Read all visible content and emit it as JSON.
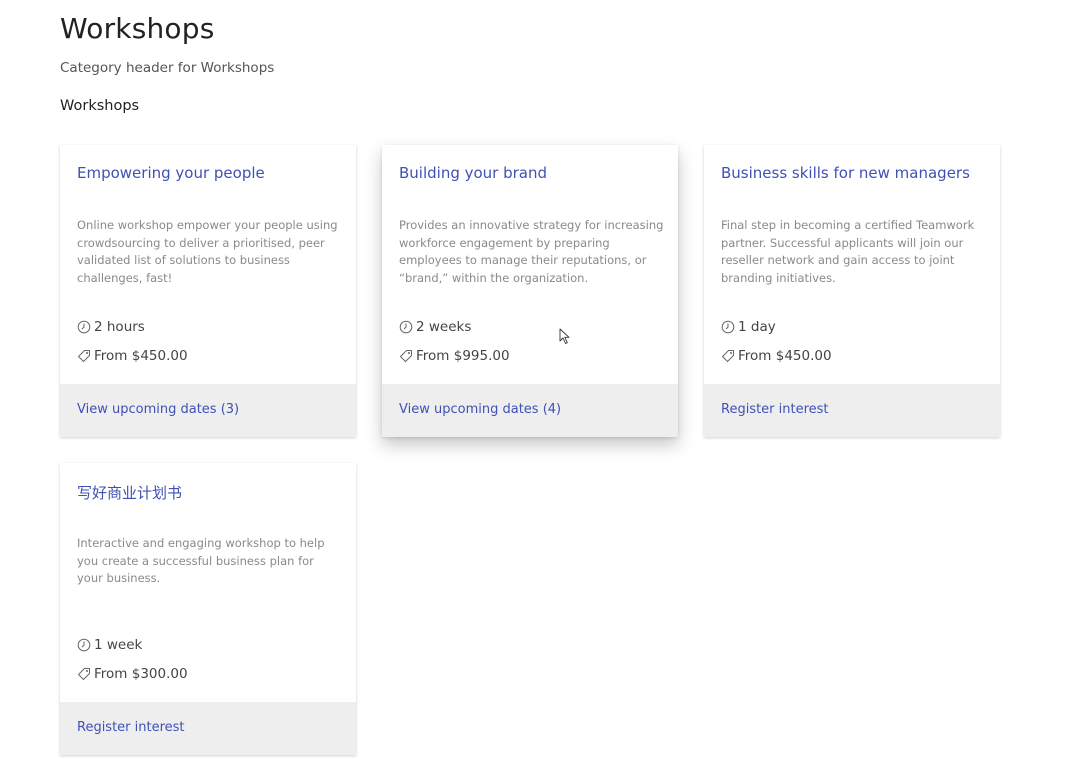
{
  "header": {
    "title": "Workshops",
    "subtitle": "Category header for Workshops",
    "section_title": "Workshops"
  },
  "colors": {
    "link": "#3f51b5",
    "footer_bg": "#eeeeee",
    "description": "#8a8a8a"
  },
  "icons": {
    "duration": "clock-icon",
    "price": "price-tag-icon"
  },
  "cards": [
    {
      "title": "Empowering your people",
      "description": "Online workshop empower your people using crowdsourcing to deliver a prioritised, peer validated list of solutions to business challenges, fast!",
      "duration": "2 hours",
      "price": "From $450.00",
      "action": "View upcoming dates (3)"
    },
    {
      "title": "Building your brand",
      "description": "Provides an innovative strategy for increasing workforce engagement by preparing employees to manage their reputations, or “brand,” within the organization.",
      "duration": "2 weeks",
      "price": "From $995.00",
      "action": "View upcoming dates (4)"
    },
    {
      "title": "Business skills for new managers",
      "description": "Final step in becoming a certified Teamwork partner. Successful applicants will join our reseller network and gain access to joint branding initiatives.",
      "duration": "1 day",
      "price": "From $450.00",
      "action": "Register interest"
    },
    {
      "title": "写好商业计划书",
      "description": "Interactive and engaging workshop to help you create a successful business plan for your business.",
      "duration": "1 week",
      "price": "From $300.00",
      "action": "Register interest"
    }
  ]
}
